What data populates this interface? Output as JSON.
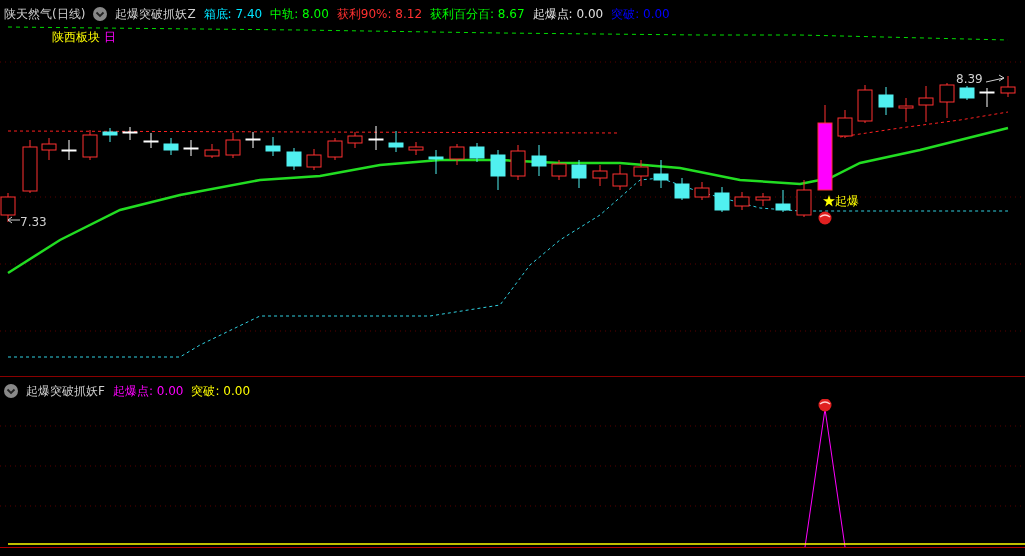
{
  "main_panel": {
    "title": "陕天然气(日线)",
    "indicator": "起爆突破抓妖Z",
    "readouts": [
      {
        "text": "箱底: 7.40",
        "color": "#00e5ff"
      },
      {
        "text": "中轨: 8.00",
        "color": "#00ff00"
      },
      {
        "text": "获利90%: 8.12",
        "color": "#ff3030"
      },
      {
        "text": "获利百分百: 8.67",
        "color": "#00ff00"
      },
      {
        "text": "起爆点: 0.00",
        "color": "#e0e0e0"
      },
      {
        "text": "突破: 0.00",
        "color": "#0000ff"
      }
    ],
    "sector": "陕西板块",
    "period": "日",
    "high_label": "8.39",
    "low_label": "7.33",
    "signal_label": "起爆"
  },
  "sub_panel": {
    "indicator": "起爆突破抓妖F",
    "readouts": [
      {
        "text": "起爆点: 0.00",
        "color": "#ff00ff"
      },
      {
        "text": "突破: 0.00",
        "color": "#ffff00"
      }
    ]
  }
}
